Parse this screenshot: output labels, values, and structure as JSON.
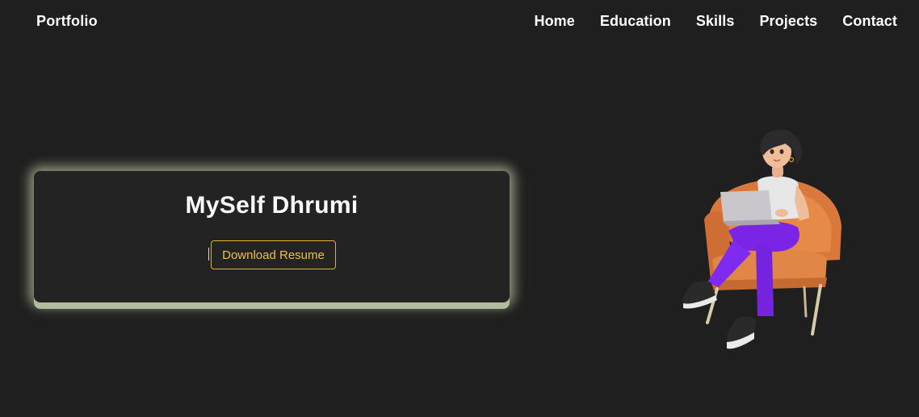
{
  "navbar": {
    "brand": "Portfolio",
    "links": [
      "Home",
      "Education",
      "Skills",
      "Projects",
      "Contact"
    ]
  },
  "hero": {
    "title": "MySelf Dhrumi",
    "button_label": "Download Resume"
  },
  "colors": {
    "background": "#1f1f1f",
    "card": "#232323",
    "card_glow": "#b2bb9b",
    "accent": "#f0c040"
  }
}
